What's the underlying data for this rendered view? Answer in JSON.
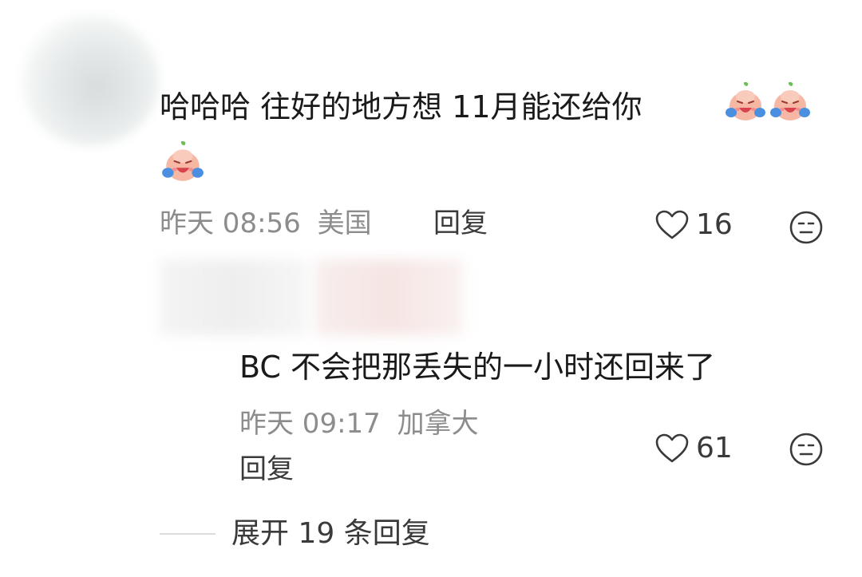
{
  "comment1": {
    "text": "哈哈哈 往好的地方想 11月能还给你",
    "emoji_name": "crying-laughing-peach-emoji",
    "emoji_count": 3,
    "time": "昨天 08:56",
    "location": "美国",
    "reply_label": "回复",
    "likes": "16"
  },
  "comment2": {
    "text": "BC 不会把那丢失的一小时还回来了",
    "time": "昨天 09:17",
    "location": "加拿大",
    "reply_label": "回复",
    "likes": "61"
  },
  "expand": {
    "label": "展开 19 条回复"
  },
  "colors": {
    "text": "#1a1a1a",
    "meta": "#8c8c8c",
    "action": "#3a3a3a",
    "emoji_body": "#f6b7a4",
    "emoji_tear": "#4a8fe0",
    "emoji_leaf": "#6bbf59"
  }
}
